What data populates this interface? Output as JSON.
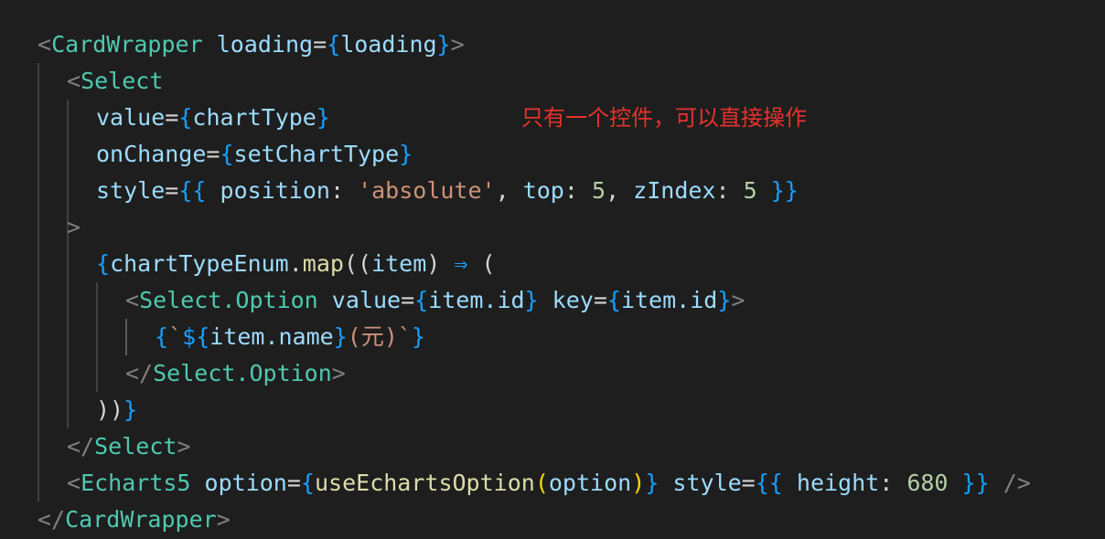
{
  "annotation": "只有一个控件，可以直接操作",
  "code": {
    "l1": {
      "open": "<",
      "tag": "CardWrapper",
      "attr": "loading",
      "eq": "=",
      "lb": "{",
      "val": "loading",
      "rb": "}",
      "close": ">"
    },
    "l2": {
      "open": "<",
      "tag": "Select"
    },
    "l3": {
      "attr": "value",
      "eq": "=",
      "lb": "{",
      "val": "chartType",
      "rb": "}"
    },
    "l4": {
      "attr": "onChange",
      "eq": "=",
      "lb": "{",
      "val": "setChartType",
      "rb": "}"
    },
    "l5": {
      "attr": "style",
      "eq": "=",
      "lb": "{",
      "lb2": "{",
      "k1": "position",
      "c1": ":",
      "s1": "'absolute'",
      "comma1": ",",
      "k2": "top",
      "c2": ":",
      "n1": "5",
      "comma2": ",",
      "k3": "zIndex",
      "c3": ":",
      "n2": "5",
      "rb2": "}",
      "rb": "}"
    },
    "l6": {
      "close": ">"
    },
    "l7": {
      "lb": "{",
      "obj": "chartTypeEnum",
      "dot": ".",
      "fn": "map",
      "p1": "((",
      "arg": "item",
      "p2": ")",
      "arrow": " ⇒ ",
      "p3": "("
    },
    "l8": {
      "open": "<",
      "tag": "Select.Option",
      "attr1": "value",
      "eq1": "=",
      "lb1": "{",
      "val1": "item.id",
      "rb1": "}",
      "attr2": "key",
      "eq2": "=",
      "lb2": "{",
      "val2": "item.id",
      "rb2": "}",
      "close": ">"
    },
    "l9": {
      "lb": "{",
      "tick1": "`",
      "dollar": "$",
      "lb2": "{",
      "val": "item.name",
      "rb2": "}",
      "text": "(元)",
      "tick2": "`",
      "rb": "}"
    },
    "l10": {
      "open": "</",
      "tag": "Select.Option",
      "close": ">"
    },
    "l11": {
      "parens": "))",
      "rb": "}"
    },
    "l12": {
      "open": "</",
      "tag": "Select",
      "close": ">"
    },
    "l13": {
      "open": "<",
      "tag": "Echarts5",
      "attr1": "option",
      "eq1": "=",
      "lb1": "{",
      "fn": "useEchartsOption",
      "p1": "(",
      "arg": "option",
      "p2": ")",
      "rb1": "}",
      "attr2": "style",
      "eq2": "=",
      "lb2": "{",
      "lb3": "{",
      "k1": "height",
      "c1": ":",
      "n1": "680",
      "rb3": "}",
      "rb2": "}",
      "close": "/>"
    },
    "l14": {
      "open": "</",
      "tag": "CardWrapper",
      "close": ">"
    }
  }
}
